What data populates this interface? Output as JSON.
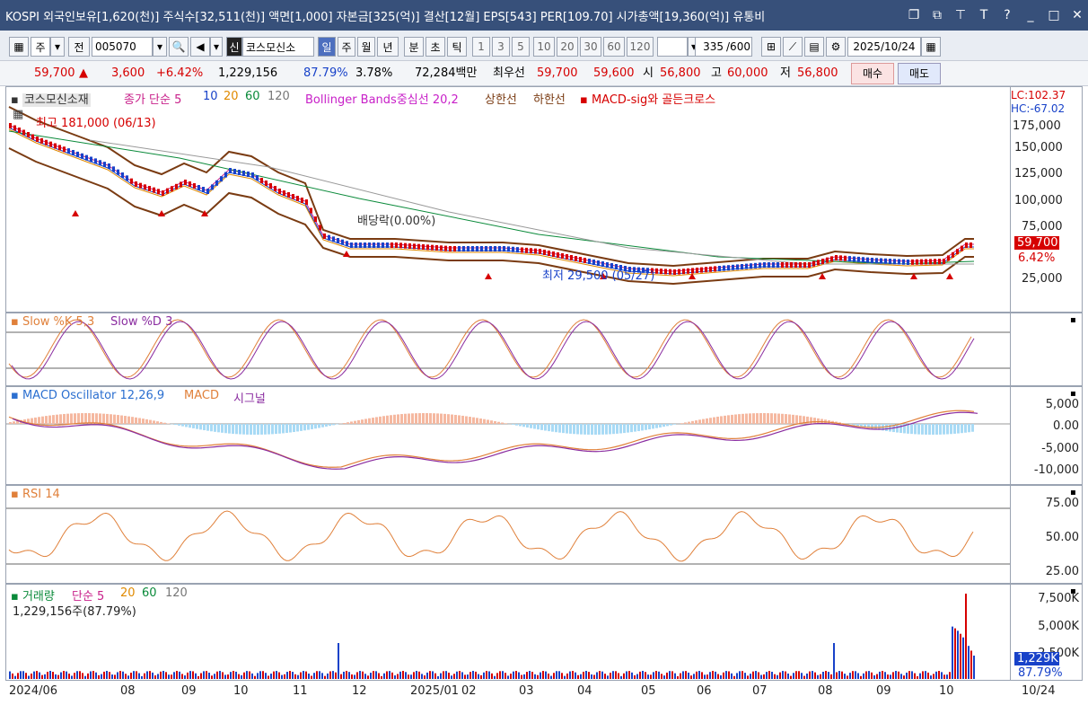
{
  "window": {
    "title": "KOSPI 외국인보유[1,620(천)] 주식수[32,511(천)] 액면[1,000] 자본금[325(억)] 결산[12월] EPS[543] PER[109.70] 시가총액[19,360(억)] 유통비",
    "icons": [
      "restore-icon",
      "copy-icon",
      "pin-icon",
      "font-icon",
      "help-icon",
      "minimize-icon",
      "maximize-icon",
      "close-icon"
    ]
  },
  "toolbar": {
    "market": "주",
    "jeon": "전",
    "code": "005070",
    "sin": "신",
    "name": "코스모신소",
    "periods": [
      "일",
      "주",
      "월",
      "년",
      "분",
      "초",
      "틱"
    ],
    "active_period": "일",
    "intervals": [
      "1",
      "3",
      "5",
      "10",
      "20",
      "30",
      "60",
      "120"
    ],
    "count": "335",
    "count_total": "/600",
    "date": "2025/10/24"
  },
  "quote": {
    "price": "59,700",
    "arrow": "▲",
    "change": "3,600",
    "pct": "+6.42%",
    "volume": "1,229,156",
    "vol_ratio": "87.79%",
    "turnover": "3.78%",
    "amount": "72,284백만",
    "best_ask_label": "최우선",
    "best_ask": "59,700",
    "best_bid": "59,600",
    "open_label": "시",
    "open": "56,800",
    "high_label": "고",
    "high": "60,000",
    "low_label": "저",
    "low": "56,800",
    "buy": "매수",
    "sell": "매도"
  },
  "price_pane": {
    "legend": [
      "코스모신소재",
      "종가 단순 5",
      "10",
      "20",
      "60",
      "120",
      "Bollinger Bands중심선 20,2",
      "상한선",
      "하한선",
      "MACD-sig와 골든크로스"
    ],
    "max_note": "최고 181,000 (06/13)",
    "min_note": "최저 29,500 (05/27)",
    "div_note": "배당락(0.00%)",
    "lc": "LC:102.37",
    "hc": "HC:-67.02",
    "ticks": [
      "175,000",
      "150,000",
      "125,000",
      "100,000",
      "75,000",
      "50,000",
      "25,000"
    ],
    "last_price": "59,700",
    "last_pct": "6.42%"
  },
  "stoch_pane": {
    "legend": [
      "Slow %K 5,3",
      "Slow %D 3"
    ]
  },
  "macd_pane": {
    "legend": [
      "MACD Oscillator 12,26,9",
      "MACD",
      "시그널"
    ],
    "ticks": [
      "5,000",
      "0.00",
      "-5,000",
      "-10,000"
    ]
  },
  "rsi_pane": {
    "legend": [
      "RSI 14"
    ],
    "ticks": [
      "75.00",
      "50.00",
      "25.00"
    ]
  },
  "vol_pane": {
    "legend": [
      "거래량",
      "단순 5",
      "20",
      "60",
      "120"
    ],
    "note": "1,229,156주(87.79%)",
    "ticks": [
      "7,500K",
      "5,000K",
      "2,500K"
    ],
    "last": "1,229K",
    "last_pct": "87.79%"
  },
  "x_labels": [
    "2024/06",
    "08",
    "09",
    "10",
    "11",
    "12",
    "2025/01",
    "02",
    "03",
    "04",
    "05",
    "06",
    "07",
    "08",
    "09",
    "10"
  ],
  "x_last": "10/24",
  "colors": {
    "up": "#d60000",
    "down": "#1842c9",
    "bb": "#7a3b12",
    "titlebar": "#37507a"
  }
}
